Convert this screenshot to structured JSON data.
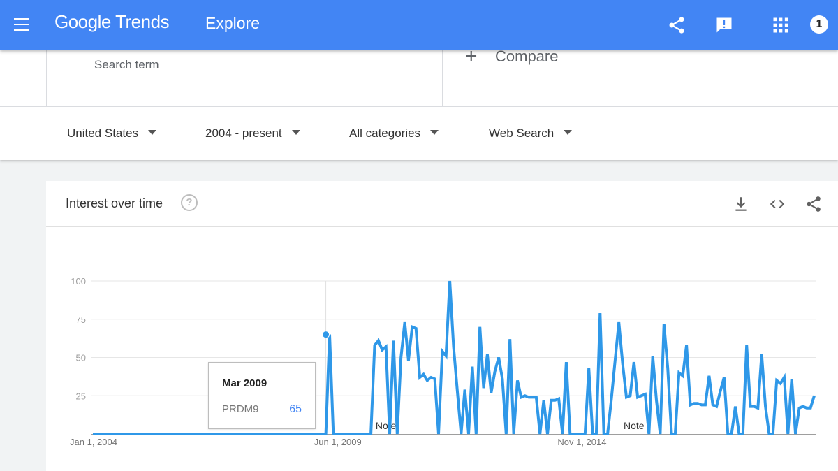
{
  "header": {
    "logo_text": "Google Trends",
    "section_title": "Explore",
    "avatar_label": "1"
  },
  "search": {
    "placeholder": "Search term",
    "compare_label": "Compare"
  },
  "filters": [
    {
      "label": "United States"
    },
    {
      "label": "2004 - present"
    },
    {
      "label": "All categories"
    },
    {
      "label": "Web Search"
    }
  ],
  "card": {
    "title": "Interest over time",
    "help_glyph": "?"
  },
  "tooltip": {
    "date": "Mar 2009",
    "term": "PRDM9",
    "value": "65"
  },
  "colors": {
    "header_bg": "#4285f4",
    "series_line": "#2f98e8",
    "tooltip_value": "#4285f4"
  },
  "chart_data": {
    "type": "line",
    "title": "Interest over time",
    "series": [
      {
        "name": "PRDM9"
      }
    ],
    "ylim": [
      0,
      100
    ],
    "y_ticks": [
      100,
      75,
      50,
      25
    ],
    "x_tick_labels": [
      "Jan 1, 2004",
      "Jun 1, 2009",
      "Nov 1, 2014"
    ],
    "x_start": "2004-01",
    "notes": [
      {
        "label": "Note",
        "date": "2010-07"
      },
      {
        "label": "Note",
        "date": "2016-01"
      }
    ],
    "highlight": {
      "date": "2009-03",
      "value": 65
    },
    "grid": true,
    "legend": "none",
    "monthly_values": [
      0,
      0,
      0,
      0,
      0,
      0,
      0,
      0,
      0,
      0,
      0,
      0,
      0,
      0,
      0,
      0,
      0,
      0,
      0,
      0,
      0,
      0,
      0,
      0,
      0,
      0,
      0,
      0,
      0,
      0,
      0,
      0,
      0,
      0,
      0,
      0,
      0,
      0,
      0,
      0,
      0,
      0,
      0,
      0,
      0,
      0,
      0,
      0,
      0,
      0,
      0,
      0,
      0,
      0,
      0,
      0,
      0,
      0,
      0,
      0,
      0,
      0,
      0,
      65,
      0,
      0,
      0,
      0,
      0,
      0,
      0,
      0,
      0,
      0,
      0,
      58,
      61,
      55,
      57,
      0,
      61,
      0,
      50,
      73,
      48,
      70,
      69,
      37,
      39,
      35,
      37,
      36,
      0,
      54,
      51,
      100,
      57,
      28,
      0,
      29,
      0,
      44,
      0,
      70,
      30,
      52,
      27,
      41,
      50,
      36,
      0,
      62,
      0,
      35,
      24,
      25,
      24,
      24,
      24,
      0,
      22,
      0,
      22,
      22,
      23,
      0,
      47,
      0,
      0,
      0,
      0,
      0,
      43,
      0,
      0,
      79,
      0,
      0,
      23,
      48,
      73,
      46,
      24,
      25,
      47,
      24,
      25,
      26,
      0,
      51,
      22,
      0,
      72,
      43,
      0,
      0,
      40,
      38,
      58,
      19,
      20,
      20,
      19,
      19,
      38,
      19,
      18,
      28,
      37,
      0,
      0,
      18,
      0,
      0,
      58,
      18,
      18,
      17,
      52,
      18,
      0,
      0,
      35,
      33,
      37,
      0,
      36,
      0,
      17,
      18,
      17,
      17,
      25
    ]
  }
}
